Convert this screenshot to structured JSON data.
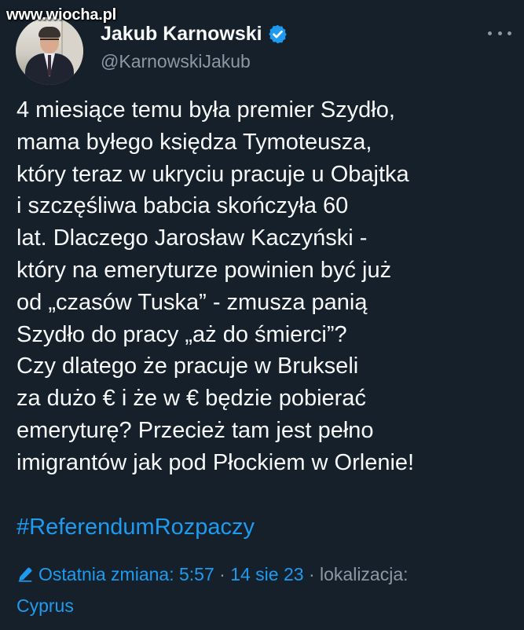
{
  "watermark": "www.wiocha.pl",
  "author": {
    "display_name": "Jakub Karnowski",
    "handle": "@KarnowskiJakub",
    "avatar_icon": "avatar-photo",
    "verified_icon": "verified-badge-icon"
  },
  "tweet": {
    "text_lines": [
      "4 miesiące temu była premier Szydło,",
      "mama byłego księdza Tymoteusza,",
      "który teraz w ukryciu pracuje u Obajtka",
      "i szczęśliwa babcia skończyła 60",
      "lat. Dlaczego Jarosław Kaczyński -",
      "który na emeryturze powinien być już",
      "od „czasów Tuska” - zmusza panią",
      "Szydło do pracy „aż do śmierci”?",
      "Czy dlatego że pracuje w Brukseli",
      "za dużo € i że w € będzie pobierać",
      "emeryturę? Przecież tam jest pełno",
      "imigrantów jak pod Płockiem w Orlenie!"
    ],
    "hashtag": "#ReferendumRozpaczy"
  },
  "meta": {
    "edited_label": "Ostatnia zmiana:",
    "time": "5:57",
    "separator": "·",
    "date": "14 sie 23",
    "location_label": "lokalizacja:",
    "location_value": "Cyprus",
    "edit_icon": "pencil-icon"
  },
  "colors": {
    "background": "#15202b",
    "text": "#f7f9f9",
    "secondary": "#8b98a5",
    "accent": "#1d9bf0"
  }
}
